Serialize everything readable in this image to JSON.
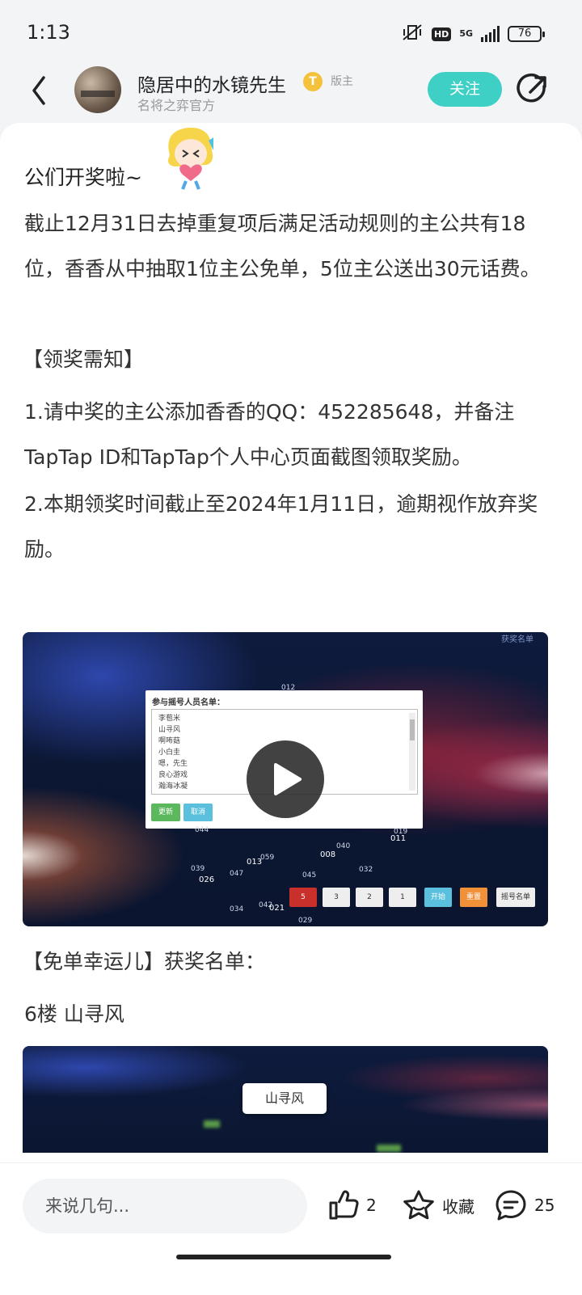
{
  "status_bar": {
    "time": "1:13",
    "hd": "HD",
    "network": "5G",
    "battery": "76"
  },
  "header": {
    "author_name": "隐居中的水镜先生",
    "badge_letter": "T",
    "role": "版主",
    "subtitle": "名将之弈官方",
    "follow_label": "关注"
  },
  "post": {
    "greeting": "公们开奖啦~",
    "paragraph1": "截止12月31日去掉重复项后满足活动规则的主公共有18位，香香从中抽取1位主公免单，5位主公送出30元话费。",
    "notice_title": "【领奖需知】",
    "notice1": "1.请中奖的主公添加香香的QQ：452285648，并备注TapTap ID和TapTap个人中心页面截图领取奖励。",
    "notice2": "2.本期领奖时间截止至2024年1月11日，逾期视作放弃奖励。",
    "winners_title": "【免单幸运儿】获奖名单：",
    "winner_line": "6楼 山寻风"
  },
  "video1": {
    "corner_label": "获奖名单",
    "dialog_title": "参与摇号人员名单：",
    "participants": [
      "李苞米",
      "山寻风",
      "啊咘菇",
      "小白圭",
      "嗯，先生",
      "良心游戏",
      "瀚海冰凝"
    ],
    "update_label": "更新",
    "cancel_label": "取消",
    "numbers": [
      "012",
      "044",
      "019",
      "011",
      "040",
      "008",
      "059",
      "013",
      "039",
      "047",
      "045",
      "032",
      "026",
      "034",
      "042",
      "021",
      "029"
    ],
    "controls": [
      "5",
      "3",
      "2",
      "1",
      "开始",
      "重置",
      "摇号名单"
    ]
  },
  "video2": {
    "winner_name": "山寻风"
  },
  "bottom_bar": {
    "comment_placeholder": "来说几句...",
    "like_count": "2",
    "favorite_label": "收藏",
    "comment_count": "25"
  }
}
